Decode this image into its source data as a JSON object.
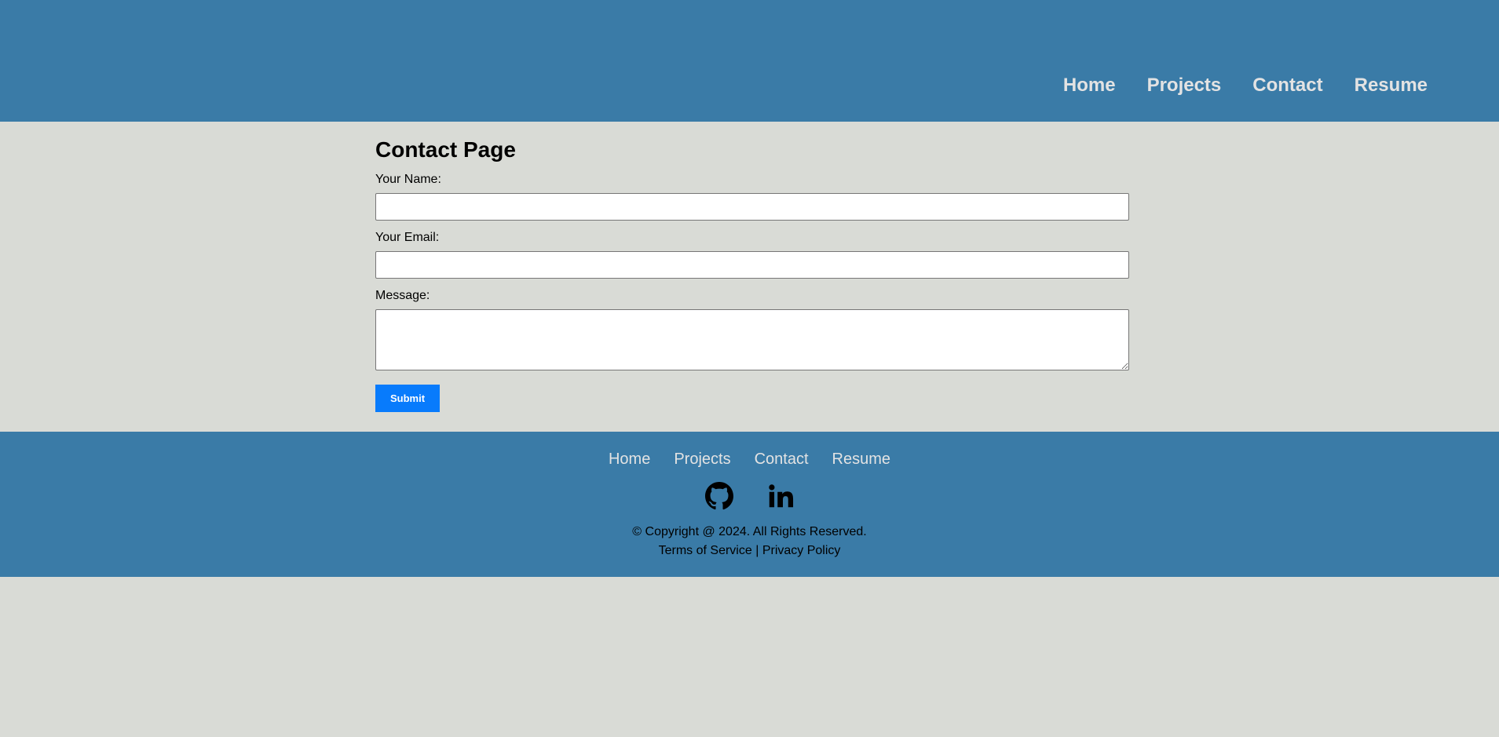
{
  "header": {
    "nav": [
      "Home",
      "Projects",
      "Contact",
      "Resume"
    ]
  },
  "main": {
    "title": "Contact Page",
    "form": {
      "name_label": "Your Name:",
      "name_value": "",
      "email_label": "Your Email:",
      "email_value": "",
      "message_label": "Message:",
      "message_value": "",
      "submit_label": "Submit"
    }
  },
  "footer": {
    "nav": [
      "Home",
      "Projects",
      "Contact",
      "Resume"
    ],
    "social": [
      "github-icon",
      "linkedin-icon"
    ],
    "copyright": "© Copyright @ 2024. All Rights Reserved.",
    "terms": "Terms of Service",
    "separator": "|",
    "privacy": "Privacy Policy"
  },
  "colors": {
    "header_bg": "#3a7ba7",
    "page_bg": "#d9dbd6",
    "nav_text": "#e3e3e3",
    "submit_bg": "#087bfc"
  }
}
